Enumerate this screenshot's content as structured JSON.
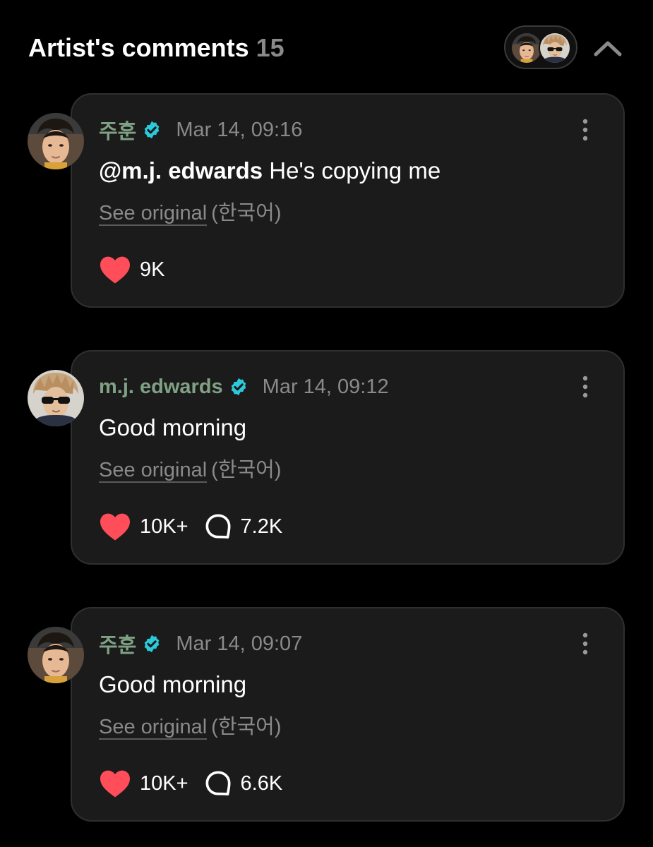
{
  "header": {
    "title": "Artist's comments",
    "count": "15"
  },
  "colors": {
    "background": "#000000",
    "card": "#1b1b1b",
    "author_green": "#7fa184",
    "verified_cyan": "#2bc9d9",
    "heart_red": "#ff4d5a",
    "muted_gray": "#8a8a8a"
  },
  "icons": {
    "verified": "verified-badge-icon",
    "like": "heart-icon",
    "reply": "speech-bubble-icon",
    "more": "more-vertical-icon",
    "collapse": "chevron-up-icon"
  },
  "comments": [
    {
      "author": "주훈",
      "timestamp": "Mar 14, 09:16",
      "mention": "@m.j. edwards",
      "text": " He's copying me",
      "see_original": "See original",
      "language": "(한국어)",
      "likes": "9K",
      "replies": ""
    },
    {
      "author": "m.j. edwards",
      "timestamp": "Mar 14, 09:12",
      "mention": "",
      "text": "Good morning",
      "see_original": "See original",
      "language": "(한국어)",
      "likes": "10K+",
      "replies": "7.2K"
    },
    {
      "author": "주훈",
      "timestamp": "Mar 14, 09:07",
      "mention": "",
      "text": "Good morning",
      "see_original": "See original",
      "language": "(한국어)",
      "likes": "10K+",
      "replies": "6.6K"
    }
  ]
}
